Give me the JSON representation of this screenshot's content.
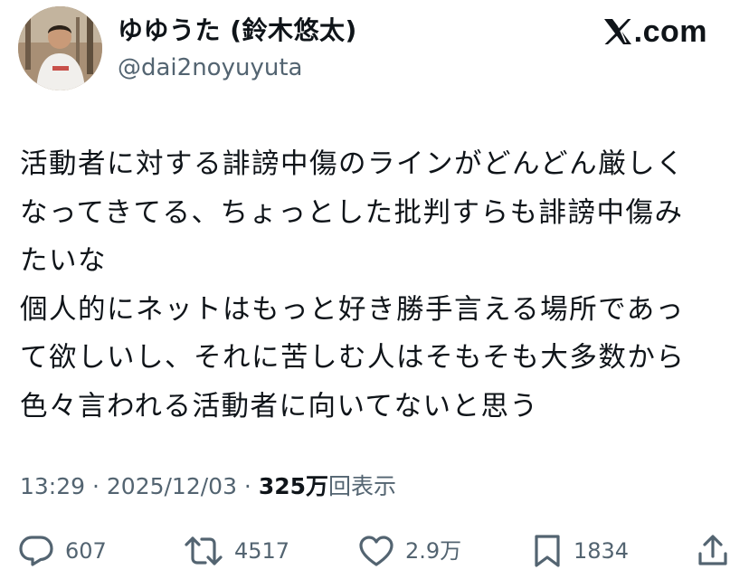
{
  "author": {
    "display_name": "ゆゆうた (鈴木悠太)",
    "handle": "@dai2noyuyuta",
    "avatar_icon": "avatar-photo"
  },
  "brand": {
    "logo_icon": "x-logo-icon",
    "text": ".com"
  },
  "tweet": {
    "lines": [
      "活動者に対する誹謗中傷のラインがどんどん厳しく",
      "なってきてる、ちょっとした批判すらも誹謗中傷み",
      "たいな",
      "個人的にネットはもっと好き勝手言える場所であっ",
      "て欲しいし、それに苦しむ人はそもそも大多数から",
      "色々言われる活動者に向いてないと思う"
    ]
  },
  "meta": {
    "time": "13:29",
    "separator": " · ",
    "date": "2025/12/03",
    "views_count": "325万",
    "views_label": "回表示"
  },
  "actions": {
    "replies": {
      "icon": "reply-icon",
      "count": "607"
    },
    "reposts": {
      "icon": "repost-icon",
      "count": "4517"
    },
    "likes": {
      "icon": "heart-icon",
      "count": "2.9万"
    },
    "bookmarks": {
      "icon": "bookmark-icon",
      "count": "1834"
    },
    "share": {
      "icon": "share-icon"
    }
  },
  "colors": {
    "text": "#0f1419",
    "secondary": "#536471",
    "background": "#ffffff"
  }
}
